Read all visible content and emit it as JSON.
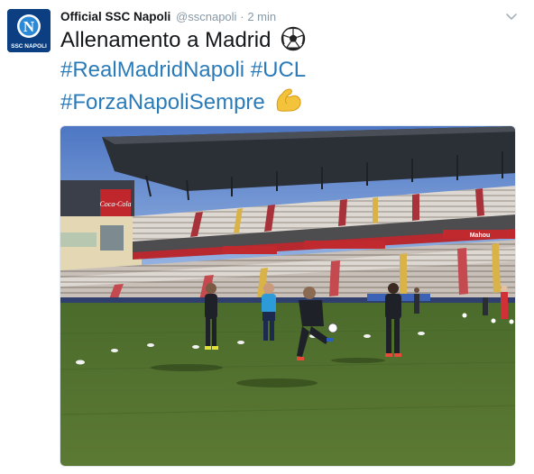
{
  "tweet": {
    "display_name": "Official SSC Napoli",
    "handle": "@sscnapoli",
    "separator": "·",
    "time": "2 min",
    "text_main": "Allenamento a Madrid",
    "hashtags_line2": [
      "#RealMadridNapoli",
      "#UCL"
    ],
    "hashtag_line3": "#ForzaNapoliSempre",
    "emoji_1": "soccer-ball",
    "emoji_2": "flexed-biceps"
  },
  "avatar": {
    "badge_letter": "N",
    "badge_text": "SSC NAPOLI",
    "bg_color": "#0b3f82"
  },
  "photo": {
    "banner_coke": "Coca-Cola",
    "banner_mahou": "Mahou"
  },
  "colors": {
    "text": "#14171a",
    "meta": "#8899a6",
    "link": "#2b7bb9"
  }
}
